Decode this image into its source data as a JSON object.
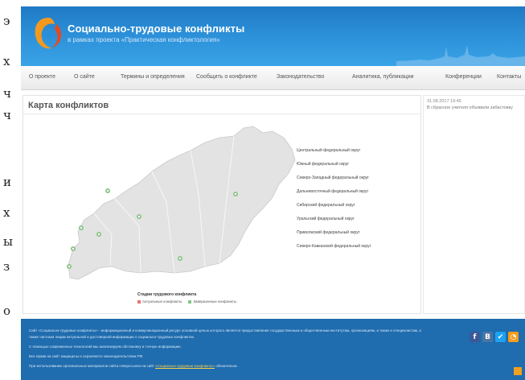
{
  "edge_glyphs": [
    "э",
    "х",
    "ч",
    "ч",
    "и",
    "х",
    "ы",
    "з",
    "о"
  ],
  "header": {
    "title": "Социально-трудовые конфликты",
    "subtitle": "в рамках проекта «Практическая конфликтология»"
  },
  "nav": {
    "items": [
      "О проекте",
      "О сайте",
      "Термины и определения",
      "Сообщить о конфликте",
      "Законодательство",
      "Аналитика, публикации",
      "Конференции",
      "Контакты"
    ]
  },
  "map_panel": {
    "title": "Карта конфликтов",
    "districts": [
      "Центральный федеральный округ",
      "Южный федеральный округ",
      "Северо-Западный федеральный округ",
      "Дальневосточный федеральный округ",
      "Сибирский федеральный округ",
      "Уральский федеральный округ",
      "Приволжский федеральный округ",
      "Северо-Кавказский федеральный округ"
    ],
    "legend": {
      "title": "Стадии трудового конфликта",
      "items": [
        {
          "label": "Актуальные конфликты",
          "color": "#e57373"
        },
        {
          "label": "Завершенные конфликты",
          "color": "#81c784"
        }
      ]
    }
  },
  "sidebar": {
    "news_date": "31.08.2017 19:45",
    "news_text": "В г.Красное учителя объявили забастовку"
  },
  "footer": {
    "lines": [
      "Сайт «Социально-трудовые конфликты» - информационный и коммуникационный ресурс основной целью которого является предоставление государственным и общественным институтам, организациям, а также и специалистам, а",
      "также частным лицам актуальной и достоверной информации о социально-трудовых конфликтах.",
      "С помощью современных технологий мы анализируем обстановку и точную информацию.",
      "Все права на сайт защищены и охраняются законодательством РФ.",
      "При использовании оригинальных материалов сайта гиперссылка на сайт"
    ],
    "link_text": "«Социально-трудовые конфликты»",
    "link_suffix": " обязательна."
  },
  "colors": {
    "header_blue": "#2b8fd8",
    "footer_blue": "#1f6cae",
    "logo_orange": "#f39a1e",
    "map_fill": "#e3e3e3"
  },
  "icons": [
    "logo-icon",
    "facebook-icon",
    "vk-icon",
    "twitter-icon",
    "rss-icon",
    "map-pin-icon"
  ]
}
